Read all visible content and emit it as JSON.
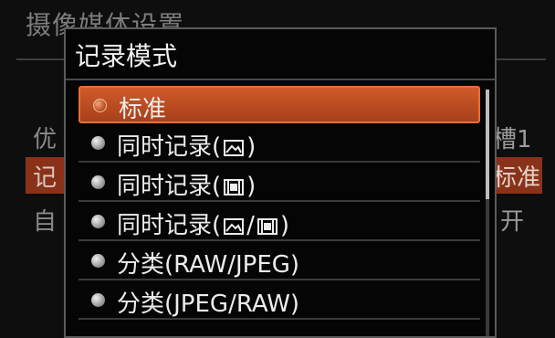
{
  "background_menu": {
    "title": "摄像媒体设置",
    "left_items": [
      "优",
      "记",
      "自"
    ],
    "right_values": [
      "槽1",
      "标准",
      "开"
    ]
  },
  "dialog": {
    "title": "记录模式",
    "items": [
      {
        "label": "标准",
        "selected": true
      },
      {
        "label_prefix": "同时记录(",
        "icon": "photo-icon",
        "label_suffix": ")"
      },
      {
        "label_prefix": "同时记录(",
        "icon": "film-icon",
        "label_suffix": ")"
      },
      {
        "label_prefix": "同时记录(",
        "icon": "photo-icon",
        "separator": "/",
        "icon2": "film-icon",
        "label_suffix": ")"
      },
      {
        "label": "分类(RAW/JPEG)"
      },
      {
        "label": "分类(JPEG/RAW)"
      }
    ]
  },
  "colors": {
    "accent": "#c44f22",
    "background": "#0e0e0e"
  }
}
